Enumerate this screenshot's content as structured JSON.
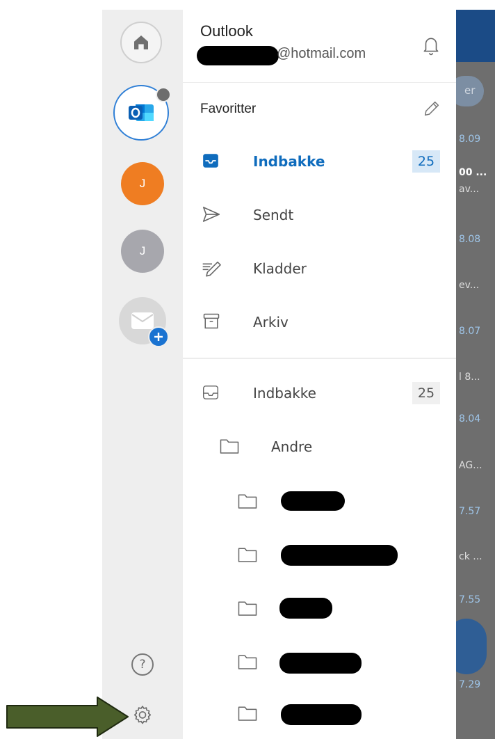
{
  "rail": {
    "avatars": [
      {
        "letter": "J",
        "color": "#ef7d22"
      },
      {
        "letter": "J",
        "color": "#a7a7ad"
      }
    ]
  },
  "header": {
    "app_name": "Outlook",
    "email_suffix": "@hotmail.com"
  },
  "favorites": {
    "heading": "Favoritter",
    "items": [
      {
        "label": "Indbakke",
        "count": "25",
        "active": true,
        "icon": "inbox-icon"
      },
      {
        "label": "Sendt",
        "icon": "send-icon"
      },
      {
        "label": "Kladder",
        "icon": "drafts-icon"
      },
      {
        "label": "Arkiv",
        "icon": "archive-icon"
      }
    ]
  },
  "folders": {
    "items": [
      {
        "label": "Indbakke",
        "count": "25",
        "icon": "inbox-icon"
      },
      {
        "label": "Andre",
        "icon": "folder-icon"
      }
    ]
  },
  "background": {
    "partial_button": "er",
    "snippets": [
      "8.09",
      "00 ...",
      "av...",
      "8.08",
      "ev...",
      "8.07",
      "l 8...",
      "8.04",
      "AG...",
      "7.57",
      "ck ...",
      "7.55",
      "7.29"
    ]
  },
  "colors": {
    "accent": "#0f6cbd",
    "rail_bg": "#eeeeee",
    "arrow": "#4a5e2a"
  }
}
